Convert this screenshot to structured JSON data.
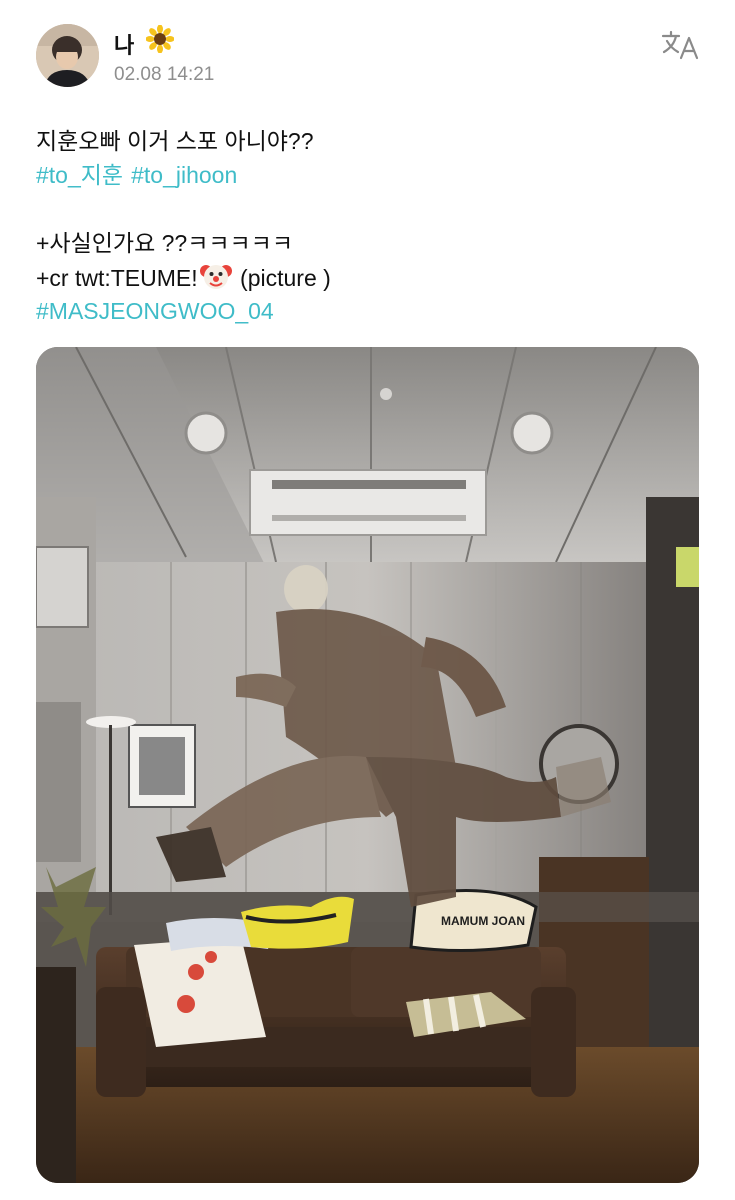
{
  "author": {
    "name": "나",
    "emoji_icon": "sunflower-icon",
    "timestamp": "02.08 14:21"
  },
  "header": {
    "translate_icon": "translate-icon"
  },
  "post": {
    "line1": "지훈오빠 이거 스포 아니야??",
    "tags1": [
      "#to_지훈",
      "#to_jihoon"
    ],
    "line3": "+사실인가요 ??ㅋㅋㅋㅋㅋ",
    "line4_prefix": "+cr twt:TEUME!",
    "line4_emoji_icon": "clown-face-icon",
    "line4_suffix": "(picture )",
    "tags2": [
      "#MASJEONGWOO_04"
    ]
  },
  "photo": {
    "pillow_text": "MAMUM JOAN"
  },
  "colors": {
    "hashtag": "#3fbcc8",
    "timestamp": "#8e8e8e",
    "text": "#111111"
  }
}
